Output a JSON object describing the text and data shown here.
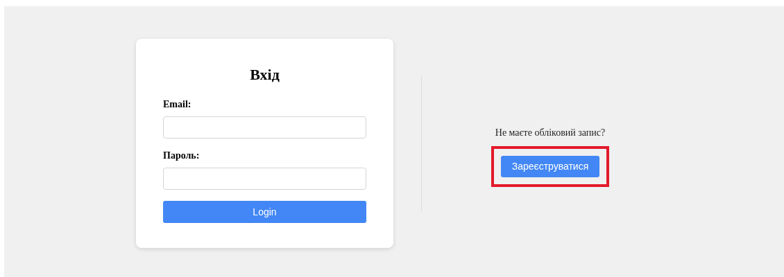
{
  "login_form": {
    "title": "Вхід",
    "fields": [
      {
        "label": "Email:"
      },
      {
        "label": "Пароль:"
      }
    ],
    "submit_button": "Login"
  },
  "register": {
    "prompt": "Не маєте обліковий запис?",
    "button": "Зареєструватися",
    "highlighted": true
  }
}
